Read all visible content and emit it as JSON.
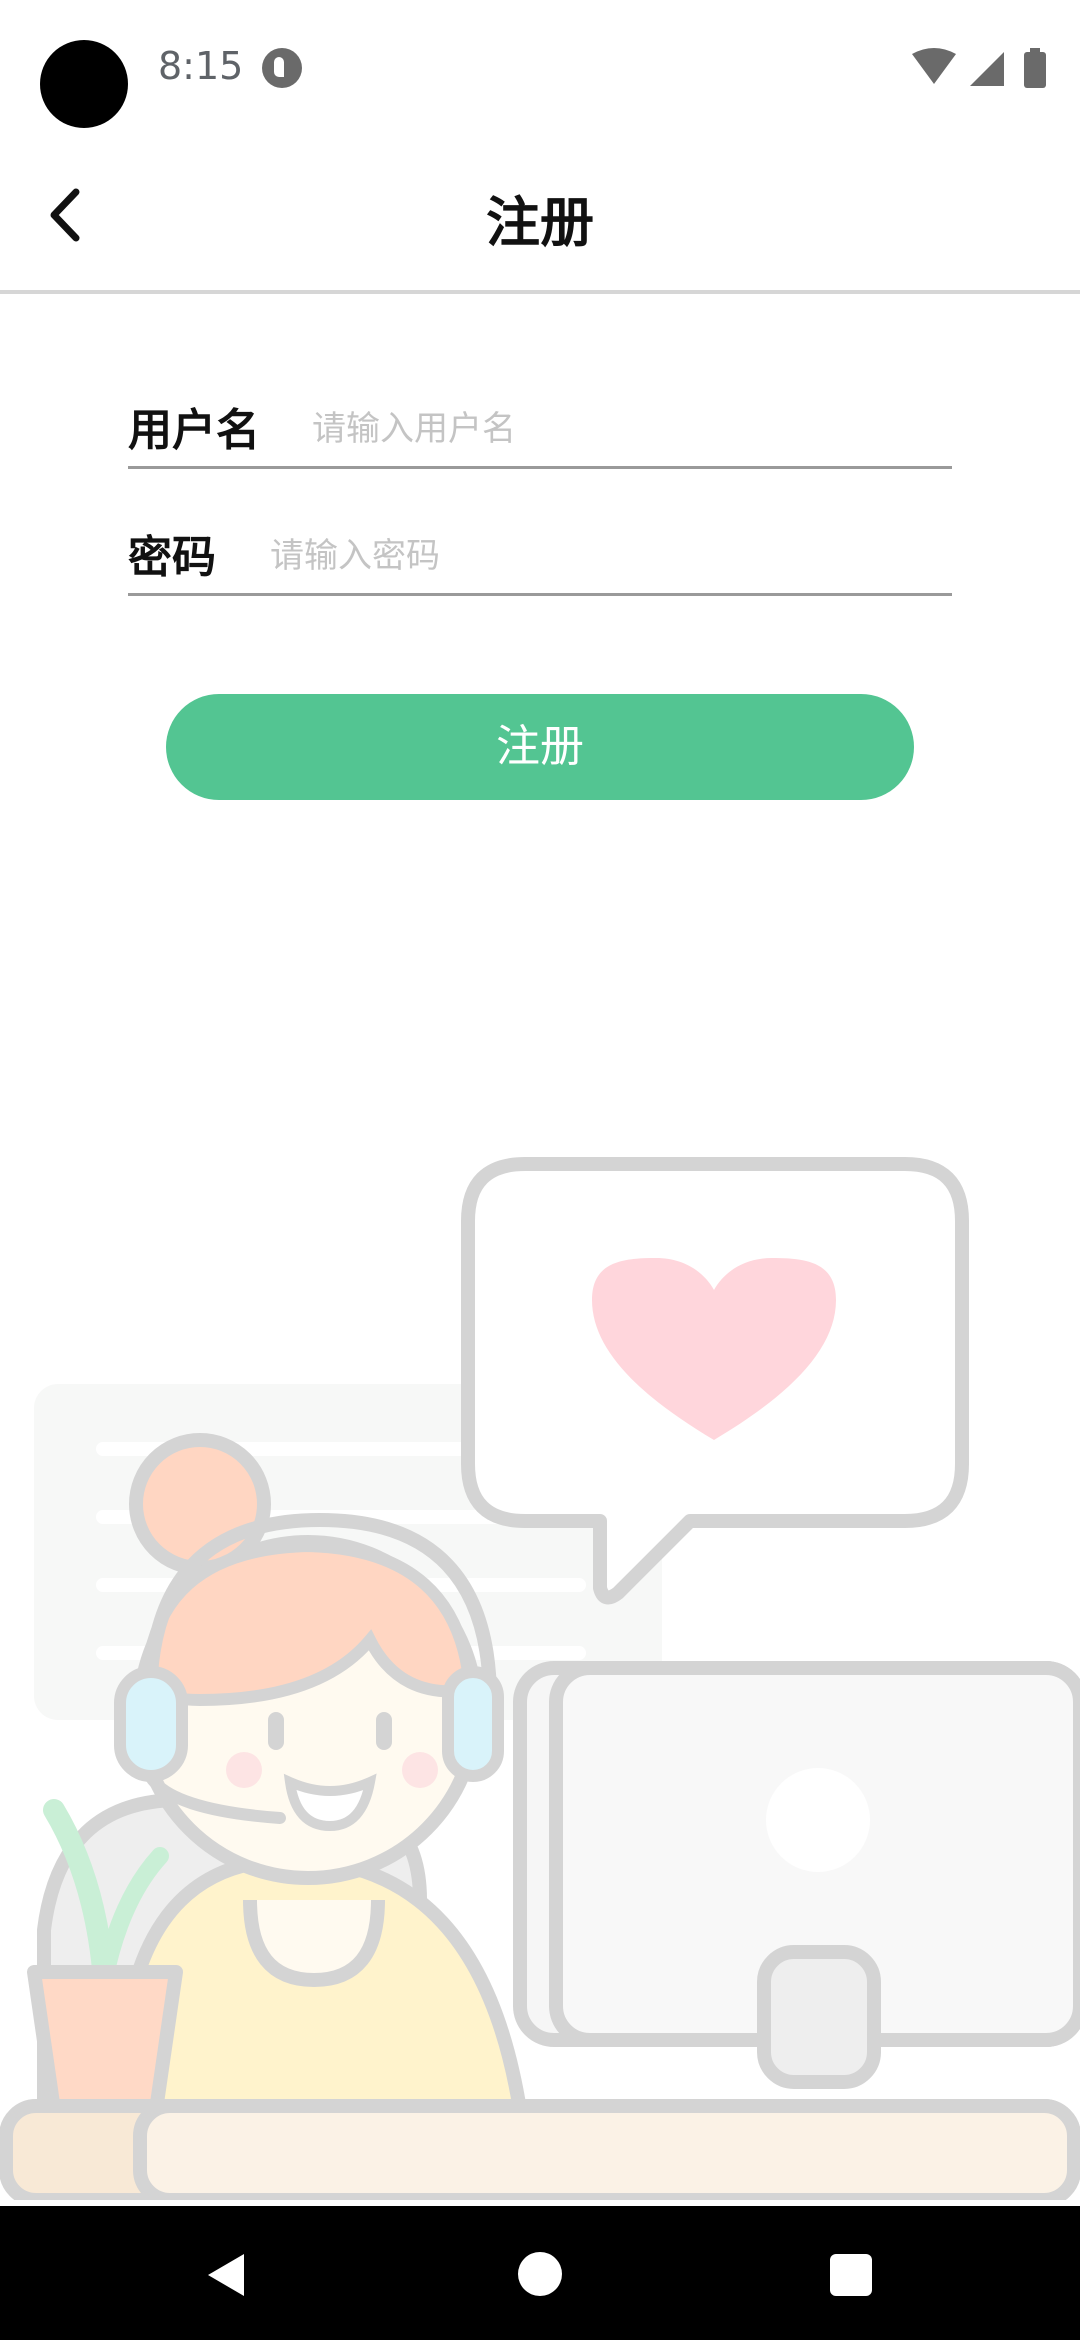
{
  "status_bar": {
    "time": "8:15",
    "icons": [
      "wifi-icon",
      "cell-signal-icon",
      "battery-icon"
    ]
  },
  "app_bar": {
    "title": "注册",
    "back_icon": "back-arrow-icon"
  },
  "form": {
    "username": {
      "label": "用户名",
      "placeholder": "请输入用户名",
      "value": ""
    },
    "password": {
      "label": "密码",
      "placeholder": "请输入密码",
      "value": ""
    }
  },
  "submit_button": {
    "label": "注册"
  },
  "colors": {
    "accent": "#53c592",
    "heart": "#ffd6dc",
    "text": "#111111",
    "placeholder": "#c4c4c4"
  },
  "nav_bar": {
    "icons": [
      "nav-back-icon",
      "nav-home-icon",
      "nav-recents-icon"
    ]
  }
}
